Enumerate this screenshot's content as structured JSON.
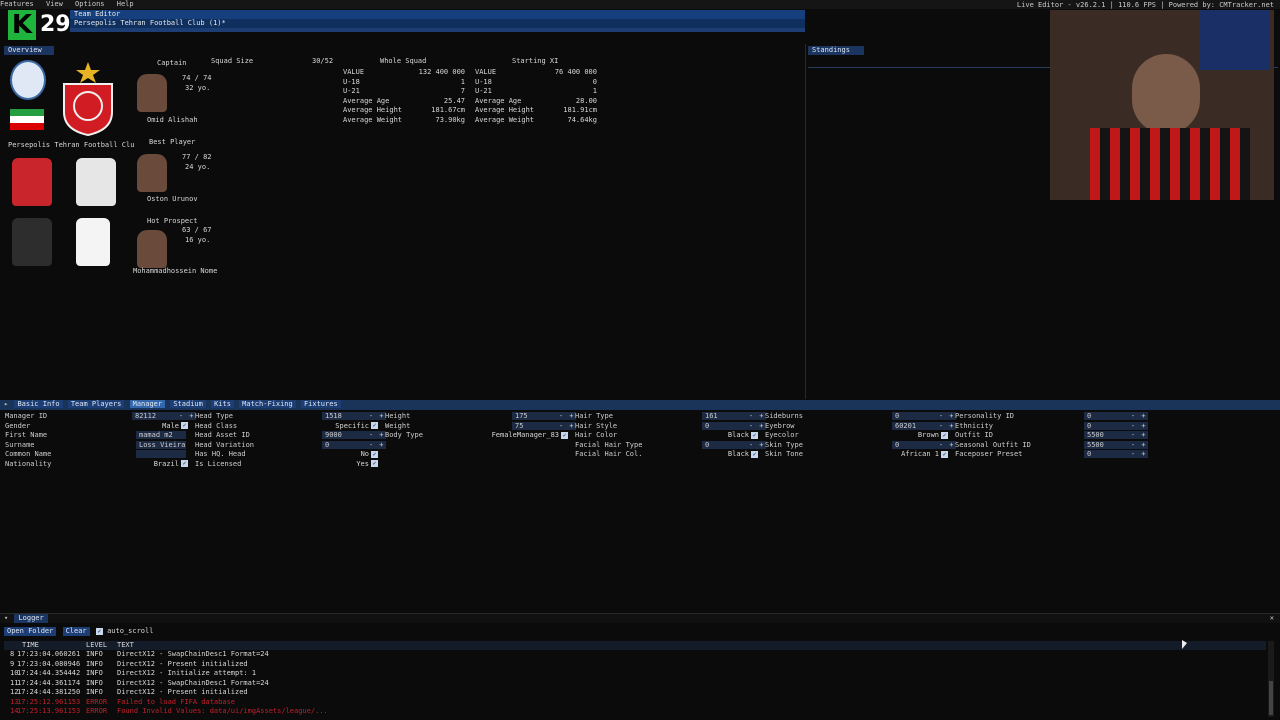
{
  "menu": [
    "Features",
    "View",
    "Options",
    "Help"
  ],
  "titlebar": "Live Editor - v26.2.1 | 110.6 FPS | Powered by: CMTracker.net",
  "badge": {
    "letter": "K",
    "number": "29"
  },
  "tabs": {
    "line1": "Team Editor",
    "line2": "Persepolis Tehran Football Club (1)*"
  },
  "overview": {
    "title": "Overview",
    "club_name": "Persepolis Tehran Football Clu",
    "captain": {
      "heading": "Captain",
      "rating": "74 / 74",
      "age": "32 yo.",
      "name": "Omid Alishah"
    },
    "best": {
      "heading": "Best Player",
      "rating": "77 / 82",
      "age": "24 yo.",
      "name": "Oston Urunov"
    },
    "prospect": {
      "heading": "Hot Prospect",
      "rating": "63 / 67",
      "age": "16 yo.",
      "name": "Mohammadhossein Nome"
    },
    "squad_size_label": "Squad Size",
    "squad_size": "30/52",
    "whole_squad": {
      "heading": "Whole Squad",
      "rows": [
        {
          "k": "VALUE",
          "v": "132 400 000"
        },
        {
          "k": "U-18",
          "v": "1"
        },
        {
          "k": "U-21",
          "v": "7"
        },
        {
          "k": "Average Age",
          "v": "25.47"
        },
        {
          "k": "Average Height",
          "v": "181.67cm"
        },
        {
          "k": "Average Weight",
          "v": "73.90kg"
        }
      ]
    },
    "starting_xi": {
      "heading": "Starting XI",
      "rows": [
        {
          "k": "VALUE",
          "v": "76 400 000"
        },
        {
          "k": "U-18",
          "v": "0"
        },
        {
          "k": "U-21",
          "v": "1"
        },
        {
          "k": "Average Age",
          "v": "28.00"
        },
        {
          "k": "Average Height",
          "v": "181.91cm"
        },
        {
          "k": "Average Weight",
          "v": "74.64kg"
        }
      ]
    }
  },
  "standings": {
    "title": "Standings"
  },
  "editor_tabs": [
    "Basic Info",
    "Team Players",
    "Manager",
    "Stadium",
    "Kits",
    "Match-Fixing",
    "Fixtures"
  ],
  "manager": {
    "col1": [
      {
        "k": "Manager ID",
        "v": "82112",
        "type": "spin"
      },
      {
        "k": "Gender",
        "v": "Male",
        "type": "check"
      },
      {
        "k": "First Name",
        "v": "mamad m2",
        "type": "text"
      },
      {
        "k": "Surname",
        "v": "Loss Vieira",
        "type": "text"
      },
      {
        "k": "Common Name",
        "v": "",
        "type": "text"
      },
      {
        "k": "Nationality",
        "v": "Brazil",
        "type": "check"
      }
    ],
    "col2": [
      {
        "k": "Head Type",
        "v": "1518",
        "type": "spin"
      },
      {
        "k": "Head Class",
        "v": "Specific",
        "type": "check"
      },
      {
        "k": "Head Asset ID",
        "v": "9000",
        "type": "spin"
      },
      {
        "k": "Head Variation",
        "v": "0",
        "type": "spin"
      },
      {
        "k": "Has HQ. Head",
        "v": "No",
        "type": "check"
      },
      {
        "k": "Is Licensed",
        "v": "Yes",
        "type": "check"
      }
    ],
    "col3": [
      {
        "k": "Height",
        "v": "175",
        "type": "spin"
      },
      {
        "k": "Weight",
        "v": "75",
        "type": "spin"
      },
      {
        "k": "Body Type",
        "v": "FemaleManager_83",
        "type": "check"
      }
    ],
    "col4": [
      {
        "k": "Hair Type",
        "v": "161",
        "type": "spin"
      },
      {
        "k": "Hair Style",
        "v": "0",
        "type": "spin"
      },
      {
        "k": "Hair Color",
        "v": "Black",
        "type": "check"
      },
      {
        "k": "Facial Hair Type",
        "v": "0",
        "type": "spin"
      },
      {
        "k": "Facial Hair Col.",
        "v": "Black",
        "type": "check"
      }
    ],
    "col5": [
      {
        "k": "Sideburns",
        "v": "0",
        "type": "spin"
      },
      {
        "k": "Eyebrow",
        "v": "60201",
        "type": "spin"
      },
      {
        "k": "Eyecolor",
        "v": "Brown",
        "type": "check"
      },
      {
        "k": "Skin Type",
        "v": "0",
        "type": "spin"
      },
      {
        "k": "Skin Tone",
        "v": "African 1",
        "type": "check"
      }
    ],
    "col6": [
      {
        "k": "Personality ID",
        "v": "0",
        "type": "spin"
      },
      {
        "k": "Ethnicity",
        "v": "0",
        "type": "spin"
      },
      {
        "k": "Outfit ID",
        "v": "5500",
        "type": "spin"
      },
      {
        "k": "Seasonal Outfit ID",
        "v": "5500",
        "type": "spin"
      },
      {
        "k": "Faceposer Preset",
        "v": "0",
        "type": "spin"
      }
    ]
  },
  "logger": {
    "title": "Logger",
    "open_folder": "Open Folder",
    "clear": "Clear",
    "auto_scroll": "auto_scroll",
    "cols": [
      "TIME",
      "LEVEL",
      "TEXT"
    ],
    "rows": [
      {
        "n": "8",
        "time": "17:23:04.060261",
        "level": "INFO",
        "text": "DirectX12 - SwapChainDesc1 Format=24",
        "err": false
      },
      {
        "n": "9",
        "time": "17:23:04.080946",
        "level": "INFO",
        "text": "DirectX12 - Present initialized",
        "err": false
      },
      {
        "n": "10",
        "time": "17:24:44.354442",
        "level": "INFO",
        "text": "DirectX12 - Initialize attempt: 1",
        "err": false
      },
      {
        "n": "11",
        "time": "17:24:44.361174",
        "level": "INFO",
        "text": "DirectX12 - SwapChainDesc1 Format=24",
        "err": false
      },
      {
        "n": "12",
        "time": "17:24:44.381250",
        "level": "INFO",
        "text": "DirectX12 - Present initialized",
        "err": false
      },
      {
        "n": "13",
        "time": "17:25:12.961153",
        "level": "ERROR",
        "text": "Failed to load FIFA database",
        "err": true
      },
      {
        "n": "14",
        "time": "17:25:13.961153",
        "level": "ERROR",
        "text": "Found Invalid Values: data/ui/imgAssets/league/...",
        "err": true
      }
    ]
  },
  "colors": {
    "accent": "#1d3e74",
    "error": "#c0202a",
    "badge_green": "#1fb43b"
  }
}
